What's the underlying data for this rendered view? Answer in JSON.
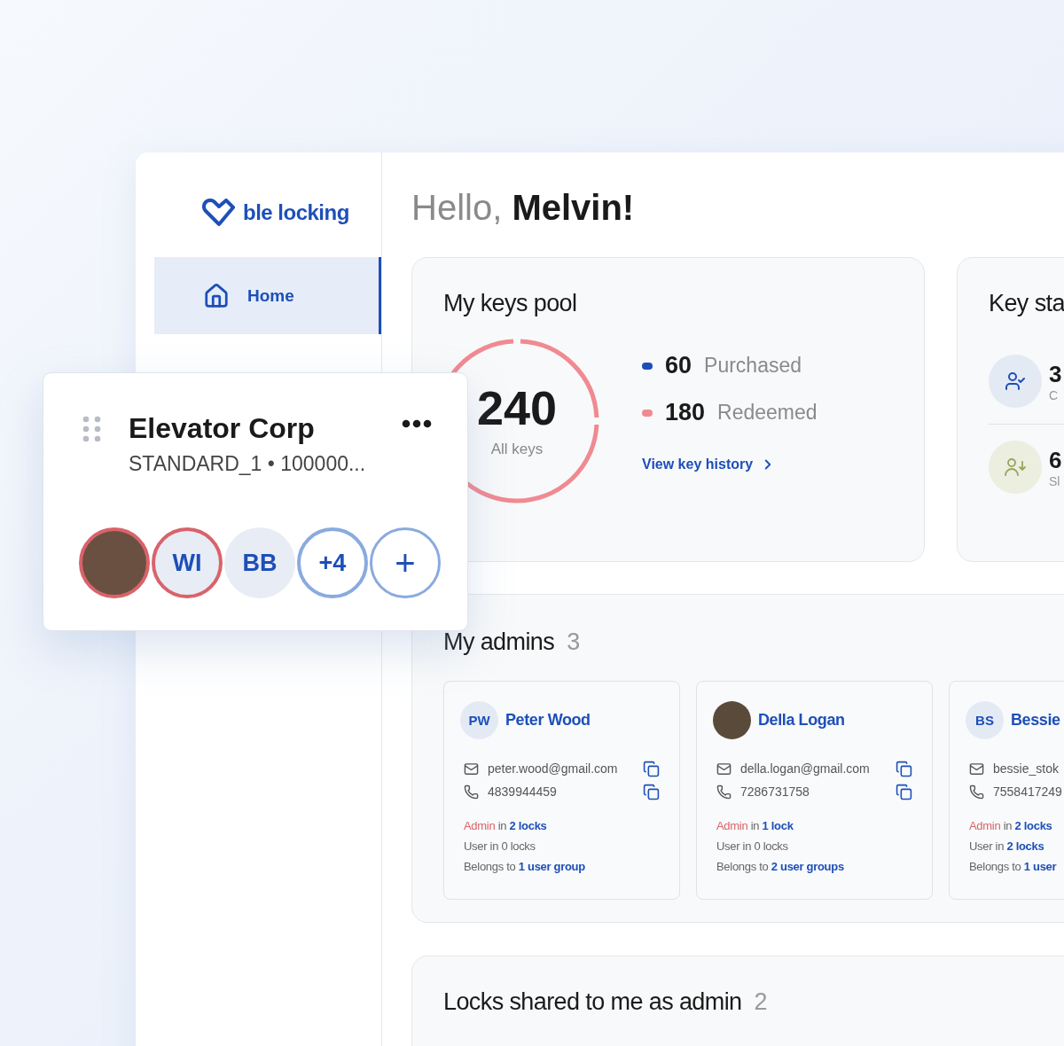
{
  "sidebar": {
    "logo": "ble locking",
    "items": [
      {
        "label": "Home",
        "selected": true
      }
    ]
  },
  "greeting": {
    "text": "Hello,",
    "name": "Melvin!"
  },
  "keys_pool": {
    "title": "My keys pool",
    "total": "240",
    "total_label": "All keys",
    "legend": [
      {
        "value": "60",
        "label": "Purchased",
        "color": "#1d4fb8"
      },
      {
        "value": "180",
        "label": "Redeemed",
        "color": "#f08a92"
      }
    ],
    "link": "View key history"
  },
  "key_status": {
    "title": "Key sta",
    "items": [
      {
        "kind": "check",
        "value": "3",
        "label": "C"
      },
      {
        "kind": "down",
        "value": "6",
        "label": "Sl"
      }
    ]
  },
  "admins": {
    "title": "My admins",
    "count": "3",
    "cards": [
      {
        "avatar": {
          "kind": "initials",
          "text": "PW"
        },
        "name": "Peter Wood",
        "email": "peter.wood@gmail.com",
        "phone": "4839944459",
        "lines": [
          {
            "kind": "admin",
            "role": "Admin",
            "text": "in",
            "link": "2 locks"
          },
          {
            "kind": "plain",
            "text": "User in 0 locks"
          },
          {
            "kind": "plain",
            "text": "Belongs to",
            "link": "1 user group"
          }
        ]
      },
      {
        "avatar": {
          "kind": "photo"
        },
        "name": "Della Logan",
        "email": "della.logan@gmail.com",
        "phone": "7286731758",
        "lines": [
          {
            "kind": "admin",
            "role": "Admin",
            "text": "in",
            "link": "1 lock"
          },
          {
            "kind": "plain",
            "text": "User in 0 locks"
          },
          {
            "kind": "plain",
            "text": "Belongs to",
            "link": "2 user groups"
          }
        ]
      },
      {
        "avatar": {
          "kind": "initials",
          "text": "BS"
        },
        "name": "Bessie",
        "email": "bessie_stok",
        "phone": "7558417249",
        "lines": [
          {
            "kind": "admin",
            "role": "Admin",
            "text": "in",
            "link": "2 locks"
          },
          {
            "kind": "plain",
            "text": "User in",
            "link": "2 locks"
          },
          {
            "kind": "plain",
            "text": "Belongs to",
            "link": "1 user"
          }
        ]
      }
    ]
  },
  "locks_shared": {
    "title": "Locks shared to me as admin",
    "count": "2"
  },
  "floating_card": {
    "title": "Elevator Corp",
    "subtitle": "STANDARD_1 • 100000...",
    "members": [
      {
        "kind": "photo",
        "color": "#d9636b"
      },
      {
        "kind": "initials",
        "text": "WI",
        "color": "#d9636b"
      },
      {
        "kind": "initials",
        "text": "BB"
      },
      {
        "kind": "count",
        "text": "+4",
        "color": "#8aaadf"
      },
      {
        "kind": "add",
        "text": "+",
        "color": "#8aaadf"
      }
    ]
  }
}
